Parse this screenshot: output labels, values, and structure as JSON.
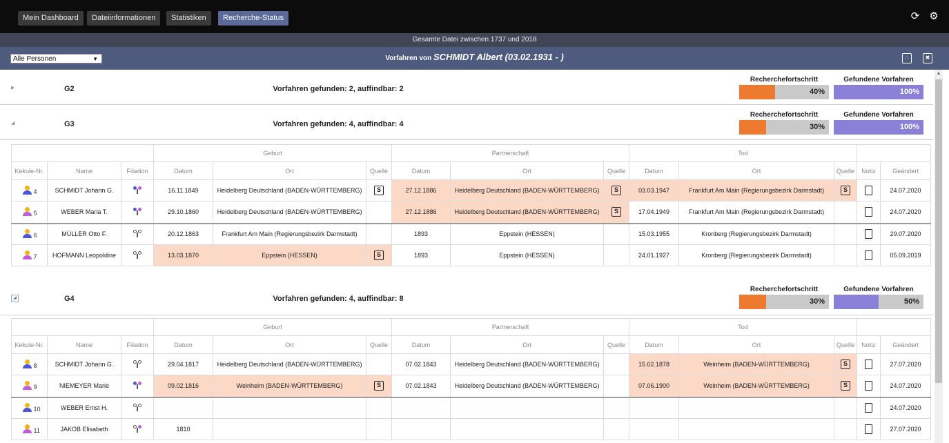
{
  "nav": {
    "items": [
      "Mein Dashboard",
      "Dateiinformationen",
      "Statistiken",
      "Recherche-Status"
    ],
    "active": "Recherche-Status",
    "refresh_icon": "refresh-icon",
    "settings_icon": "gear-icon"
  },
  "subheader": "Gesamte Datei zwischen 1737 und 2018",
  "titlebar": {
    "filter_value": "Alle Personen",
    "prefix": "Vorfahren von",
    "person": "SCHMIDT Albert (03.02.1931 - )",
    "pdf_icon": "pdf-export-icon",
    "xls_icon": "excel-export-icon"
  },
  "progress_label": "Recherchefortschritt",
  "found_label": "Gefundene Vorfahren",
  "colors": {
    "progress": "#ee7a2f",
    "found": "#8b80d8",
    "highlight": "#fbd9c6",
    "male": "#4a5ad6",
    "female": "#c25fd6"
  },
  "table_headers": {
    "groups": [
      "Geburt",
      "Partnerschaft",
      "Tod"
    ],
    "cols": [
      "Kekule-Nr.",
      "Name",
      "Filiation",
      "Datum",
      "Ort",
      "Quelle",
      "Datum",
      "Ort",
      "Quelle",
      "Datum",
      "Ort",
      "Quelle",
      "Notiz",
      "Geändert"
    ]
  },
  "generations": [
    {
      "name": "G2",
      "summary": "Vorfahren gefunden: 2, auffindbar: 2",
      "progress": 40,
      "progress_text": "40%",
      "found": 100,
      "found_text": "100%",
      "expanded": false,
      "rows": []
    },
    {
      "name": "G3",
      "summary": "Vorfahren gefunden: 4, auffindbar: 4",
      "progress": 30,
      "progress_text": "30%",
      "found": 100,
      "found_text": "100%",
      "expanded": true,
      "rows": [
        {
          "nr": "4",
          "sex": "male",
          "name": "SCHMIDT Johann G.",
          "fil": "both",
          "b_date": "16.11.1849",
          "b_place": "Heidelberg Deutschland (BADEN-WÜRTTEMBERG)",
          "b_src": true,
          "b_hl": false,
          "p_date": "27.12.1886",
          "p_place": "Heidelberg Deutschland (BADEN-WÜRTTEMBERG)",
          "p_src": true,
          "p_hl": true,
          "d_date": "03.03.1947",
          "d_place": "Frankfurt Am Main (Regierungsbezirk Darmstadt)",
          "d_src": true,
          "d_hl": true,
          "changed": "24.07.2020",
          "sep": false
        },
        {
          "nr": "5",
          "sex": "female",
          "name": "WEBER Maria T.",
          "fil": "both",
          "b_date": "29.10.1860",
          "b_place": "Heidelberg Deutschland (BADEN-WÜRTTEMBERG)",
          "b_src": false,
          "b_hl": false,
          "p_date": "27.12.1886",
          "p_place": "Heidelberg Deutschland (BADEN-WÜRTTEMBERG)",
          "p_src": true,
          "p_hl": true,
          "d_date": "17.04.1949",
          "d_place": "Frankfurt Am Main (Regierungsbezirk Darmstadt)",
          "d_src": false,
          "d_hl": false,
          "changed": "24.07.2020",
          "sep": false
        },
        {
          "nr": "6",
          "sex": "male",
          "name": "MÜLLER Otto F.",
          "fil": "none",
          "b_date": "20.12.1863",
          "b_place": "Frankfurt Am Main (Regierungsbezirk Darmstadt)",
          "b_src": false,
          "b_hl": false,
          "p_date": "1893",
          "p_place": "Eppstein (HESSEN)",
          "p_src": false,
          "p_hl": false,
          "d_date": "15.03.1955",
          "d_place": "Kronberg (Regierungsbezirk Darmstadt)",
          "d_src": false,
          "d_hl": false,
          "changed": "29.07.2020",
          "sep": true
        },
        {
          "nr": "7",
          "sex": "female",
          "name": "HOFMANN Leopoldine",
          "fil": "none",
          "b_date": "13.03.1870",
          "b_place": "Eppstein (HESSEN)",
          "b_src": true,
          "b_hl": true,
          "p_date": "1893",
          "p_place": "Eppstein (HESSEN)",
          "p_src": false,
          "p_hl": false,
          "d_date": "24.01.1927",
          "d_place": "Kronberg (Regierungsbezirk Darmstadt)",
          "d_src": false,
          "d_hl": false,
          "changed": "05.09.2019",
          "sep": false
        }
      ]
    },
    {
      "name": "G4",
      "summary": "Vorfahren gefunden: 4, auffindbar: 8",
      "progress": 30,
      "progress_text": "30%",
      "found": 50,
      "found_text": "50%",
      "expanded": true,
      "rows": [
        {
          "nr": "8",
          "sex": "male",
          "name": "SCHMIDT Johann G.",
          "fil": "none",
          "b_date": "29.04.1817",
          "b_place": "Heidelberg Deutschland (BADEN-WÜRTTEMBERG)",
          "b_src": false,
          "b_hl": false,
          "p_date": "07.02.1843",
          "p_place": "Heidelberg Deutschland (BADEN-WÜRTTEMBERG)",
          "p_src": false,
          "p_hl": false,
          "d_date": "15.02.1878",
          "d_place": "Weinheim (BADEN-WÜRTTEMBERG)",
          "d_src": true,
          "d_hl": true,
          "changed": "27.07.2020",
          "sep": false
        },
        {
          "nr": "9",
          "sex": "female",
          "name": "NIEMEYER Marie",
          "fil": "both",
          "b_date": "09.02.1816",
          "b_place": "Weinheim (BADEN-WÜRTTEMBERG)",
          "b_src": true,
          "b_hl": true,
          "p_date": "07.02.1843",
          "p_place": "Heidelberg Deutschland (BADEN-WÜRTTEMBERG)",
          "p_src": false,
          "p_hl": false,
          "d_date": "07.06.1900",
          "d_place": "Weinheim (BADEN-WÜRTTEMBERG)",
          "d_src": true,
          "d_hl": true,
          "changed": "24.07.2020",
          "sep": false
        },
        {
          "nr": "10",
          "sex": "male",
          "name": "WEBER Ernst H.",
          "fil": "none",
          "b_date": "",
          "b_place": "",
          "b_src": false,
          "b_hl": false,
          "p_date": "",
          "p_place": "",
          "p_src": false,
          "p_hl": false,
          "d_date": "",
          "d_place": "",
          "d_src": false,
          "d_hl": false,
          "changed": "24.07.2020",
          "sep": true
        },
        {
          "nr": "11",
          "sex": "female",
          "name": "JAKOB Elisabeth",
          "fil": "partial",
          "b_date": "1810",
          "b_place": "",
          "b_src": false,
          "b_hl": false,
          "p_date": "",
          "p_place": "",
          "p_src": false,
          "p_hl": false,
          "d_date": "",
          "d_place": "",
          "d_src": false,
          "d_hl": false,
          "changed": "27.07.2020",
          "sep": false
        }
      ]
    }
  ]
}
